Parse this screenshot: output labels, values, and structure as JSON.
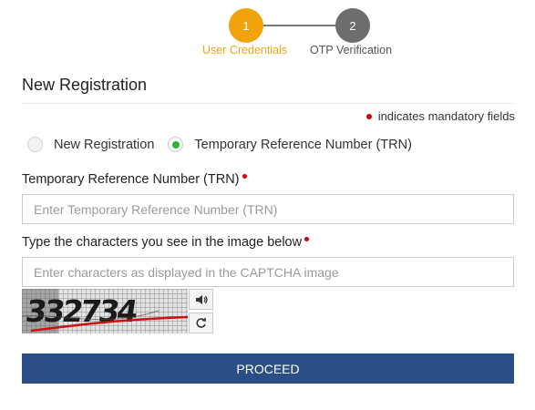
{
  "stepper": {
    "steps": [
      {
        "number": "1",
        "label": "User Credentials",
        "state": "active"
      },
      {
        "number": "2",
        "label": "OTP Verification",
        "state": "inactive"
      }
    ],
    "active_color": "#f0a30a",
    "inactive_color": "#6d6d6d"
  },
  "form": {
    "title": "New Registration",
    "mandatory_note": "indicates mandatory fields",
    "radio_options": [
      {
        "label": "New Registration",
        "checked": false
      },
      {
        "label": "Temporary Reference Number (TRN)",
        "checked": true
      }
    ],
    "trn": {
      "label": "Temporary Reference Number (TRN)",
      "placeholder": "Enter Temporary Reference Number (TRN)",
      "value": ""
    },
    "captcha": {
      "label": "Type the characters you see in the image below",
      "placeholder": "Enter characters as displayed in the CAPTCHA image",
      "value": "",
      "image_text": "332734",
      "audio_icon": "speaker-icon",
      "refresh_icon": "refresh-icon"
    },
    "proceed_label": "PROCEED"
  },
  "colors": {
    "primary_button": "#2c4e86",
    "required": "#d50000",
    "radio_checked": "#2db52d"
  }
}
